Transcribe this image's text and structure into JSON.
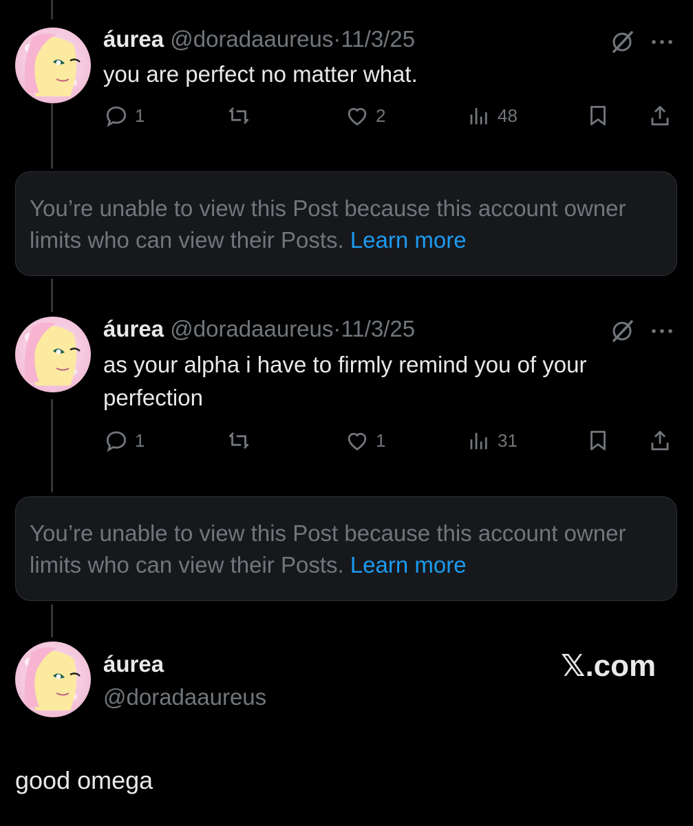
{
  "posts": [
    {
      "name": "áurea",
      "handle": "@doradaaureus",
      "separator": "·",
      "date": "11/3/25",
      "text": "you are perfect no matter what.",
      "replies": "1",
      "likes": "2",
      "views": "48"
    },
    {
      "name": "áurea",
      "handle": "@doradaaureus",
      "separator": "·",
      "date": "11/3/25",
      "text": "as your alpha i have to firmly remind you of your perfection",
      "replies": "1",
      "likes": "1",
      "views": "31"
    }
  ],
  "notice": {
    "text": "You’re unable to view this Post because this account owner limits who can view their Posts.",
    "link": "Learn more"
  },
  "card": {
    "name": "áurea",
    "handle": "@doradaaureus",
    "brand": "𝕏.com"
  },
  "quote_text": "good omega",
  "icons": [
    "reply-icon",
    "repost-icon",
    "like-icon",
    "views-icon",
    "bookmark-icon",
    "share-icon",
    "grok-icon",
    "more-icon"
  ],
  "colors": {
    "background": "#000000",
    "text": "#e7e9ea",
    "muted": "#71767b",
    "link": "#1d9bf0",
    "card": "#16181c"
  }
}
